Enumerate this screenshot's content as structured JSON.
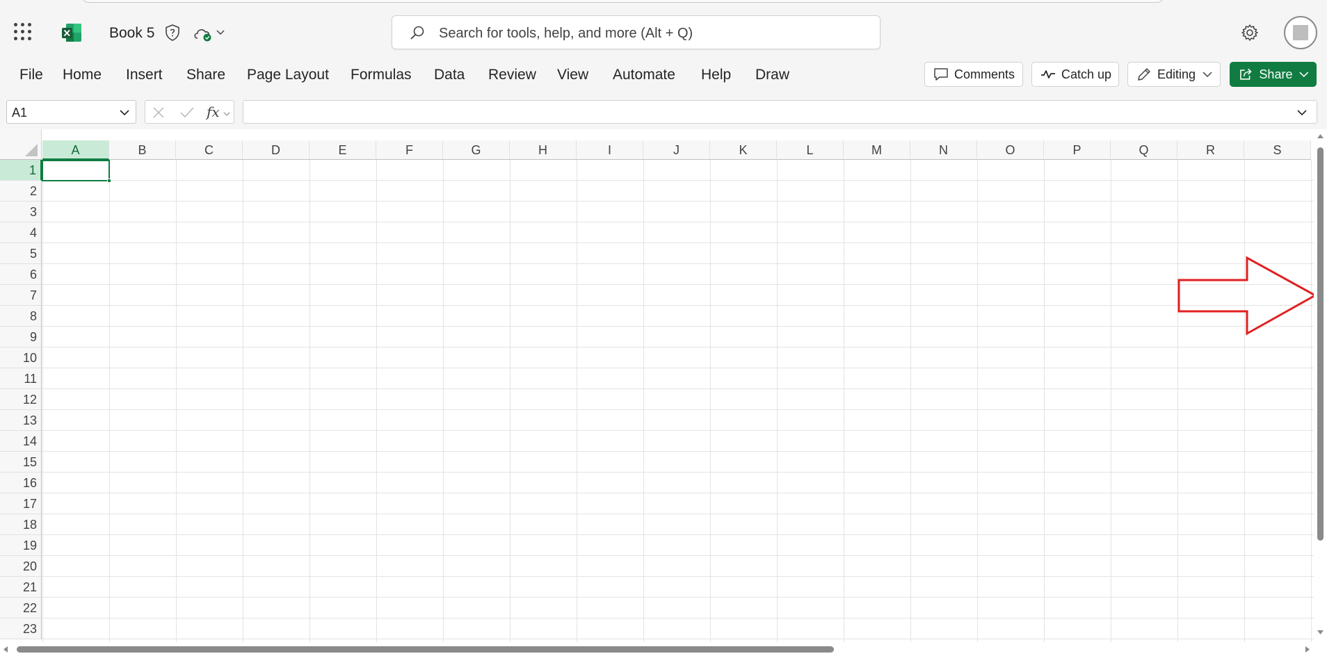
{
  "app": {
    "name": "Excel",
    "book_title": "Book 5"
  },
  "search": {
    "placeholder": "Search for tools, help, and more (Alt + Q)"
  },
  "ribbon": {
    "tabs": [
      "File",
      "Home",
      "Insert",
      "Share",
      "Page Layout",
      "Formulas",
      "Data",
      "Review",
      "View",
      "Automate",
      "Help",
      "Draw"
    ],
    "comments_label": "Comments",
    "catchup_label": "Catch up",
    "editing_label": "Editing",
    "share_label": "Share"
  },
  "formula_bar": {
    "name_box_value": "A1",
    "fx_label": "fx",
    "formula_value": ""
  },
  "grid": {
    "columns": [
      "A",
      "B",
      "C",
      "D",
      "E",
      "F",
      "G",
      "H",
      "I",
      "J",
      "K",
      "L",
      "M",
      "N",
      "O",
      "P",
      "Q",
      "R",
      "S"
    ],
    "rows": [
      "1",
      "2",
      "3",
      "4",
      "5",
      "6",
      "7",
      "8",
      "9",
      "10",
      "11",
      "12",
      "13",
      "14",
      "15",
      "16",
      "17",
      "18",
      "19",
      "20",
      "21",
      "22",
      "23"
    ],
    "selected_cell": "A1"
  },
  "colors": {
    "accent": "#107c41",
    "annotation_arrow": "#e02020"
  },
  "icons": [
    "app-launcher-icon",
    "excel-logo-icon",
    "sensitivity-shield-icon",
    "cloud-saved-icon",
    "search-icon",
    "settings-gear-icon",
    "comment-icon",
    "catch-up-icon",
    "pencil-icon",
    "share-icon"
  ]
}
